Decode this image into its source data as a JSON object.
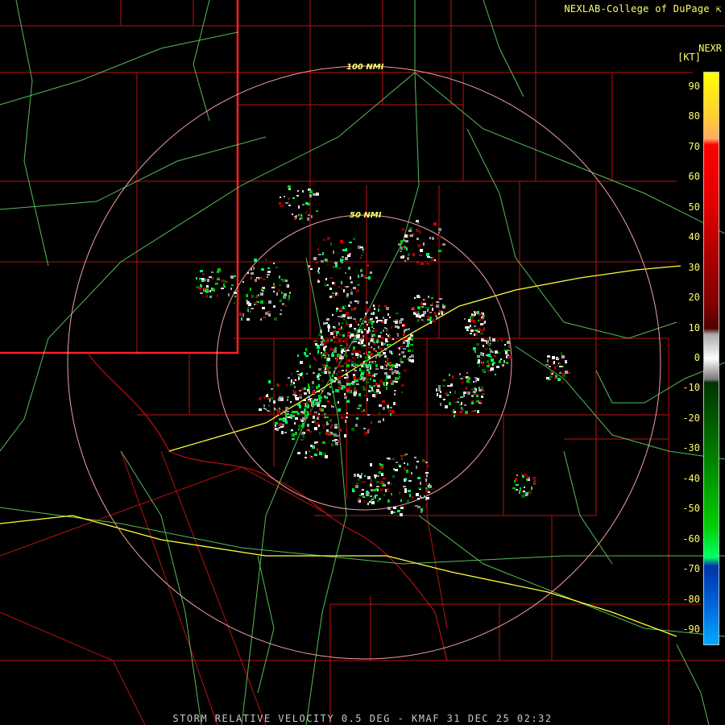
{
  "header": {
    "credit": "NEXLAB-College of DuPage",
    "credit_icon": "cursor-arrow-icon",
    "product": "NEXR",
    "units": "[KT]"
  },
  "caption": "STORM RELATIVE VELOCITY 0.5 DEG - KMAF 31 DEC 25 02:32",
  "rings": [
    {
      "label": "50 NMI",
      "range_nmi": 50
    },
    {
      "label": "100 NMI",
      "range_nmi": 100
    }
  ],
  "legend": {
    "ticks": [
      "90",
      "80",
      "70",
      "60",
      "50",
      "40",
      "30",
      "20",
      "10",
      "0",
      "-10",
      "-20",
      "-30",
      "-40",
      "-50",
      "-60",
      "-70",
      "-80",
      "-90"
    ],
    "stops": [
      {
        "v": 95,
        "c": "#ffff00"
      },
      {
        "v": 80,
        "c": "#ffcc33"
      },
      {
        "v": 73,
        "c": "#ffaa66"
      },
      {
        "v": 71,
        "c": "#ff0000"
      },
      {
        "v": 50,
        "c": "#e00000"
      },
      {
        "v": 35,
        "c": "#b00000"
      },
      {
        "v": 18,
        "c": "#800000"
      },
      {
        "v": 10,
        "c": "#500000"
      },
      {
        "v": 8,
        "c": "#aaaaaa"
      },
      {
        "v": 0,
        "c": "#ffffff"
      },
      {
        "v": -7,
        "c": "#777777"
      },
      {
        "v": -8,
        "c": "#003300"
      },
      {
        "v": -30,
        "c": "#007700"
      },
      {
        "v": -55,
        "c": "#00cc00"
      },
      {
        "v": -66,
        "c": "#00ff66"
      },
      {
        "v": -69,
        "c": "#0033aa"
      },
      {
        "v": -82,
        "c": "#0066dd"
      },
      {
        "v": -95,
        "c": "#00aaff"
      }
    ]
  },
  "colors": {
    "county_line": "#bb1111",
    "state_line": "#ff2222",
    "highway": "#66dd66",
    "interstate": "#ffff33",
    "range_ring": "#f0a0a0"
  }
}
